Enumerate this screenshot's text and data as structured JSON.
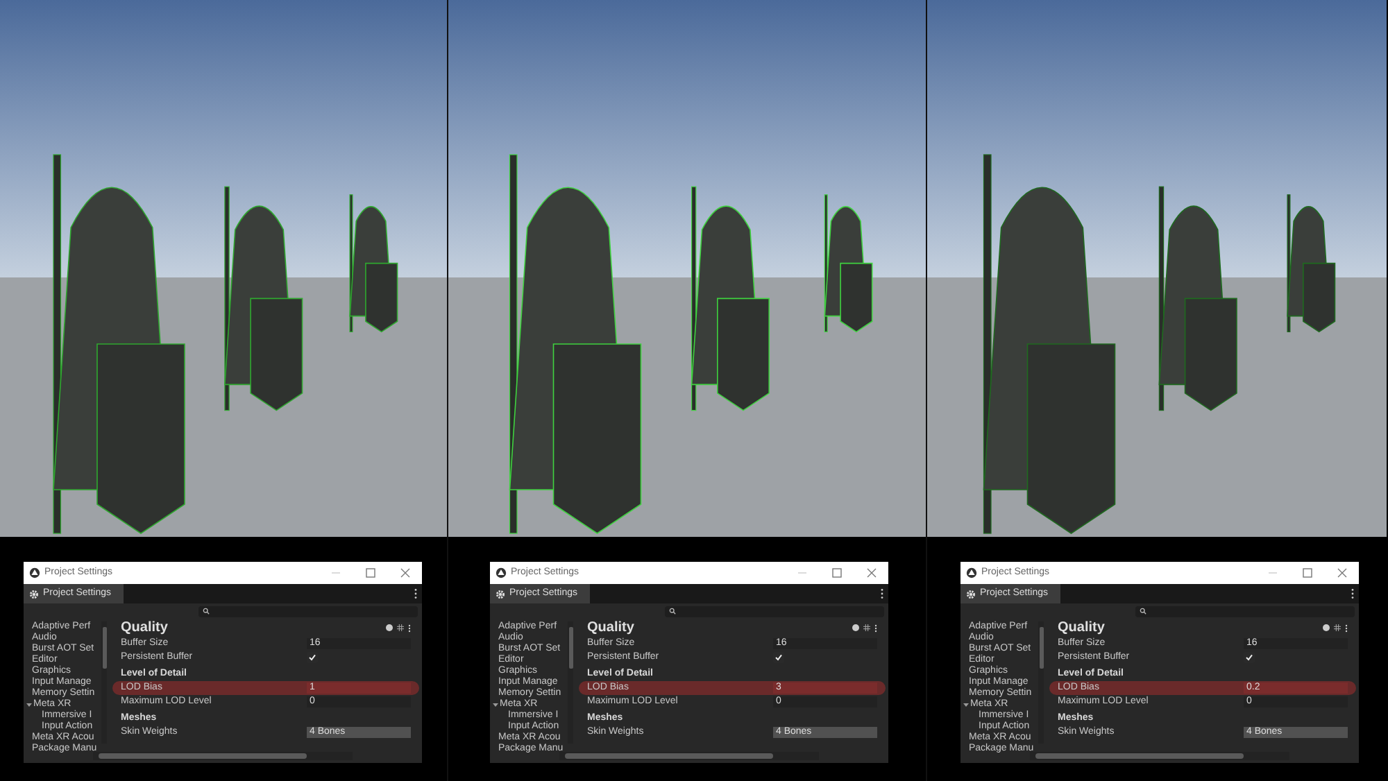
{
  "panels": [
    {
      "window": {
        "title": "Project Settings",
        "tab": "Project Settings",
        "sidebar": [
          {
            "label": "Adaptive Perf"
          },
          {
            "label": "Audio"
          },
          {
            "label": "Burst AOT Set"
          },
          {
            "label": "Editor"
          },
          {
            "label": "Graphics"
          },
          {
            "label": "Input Manage"
          },
          {
            "label": "Memory Settin"
          },
          {
            "label": "Meta XR",
            "expanded": true,
            "children": [
              {
                "label": "Immersive I"
              },
              {
                "label": "Input Action"
              }
            ]
          },
          {
            "label": "Meta XR Acou"
          },
          {
            "label": "Package Manu"
          }
        ],
        "heading": "Quality",
        "rows": [
          {
            "kind": "field",
            "label": "Buffer Size",
            "value": "16",
            "highlighted": false
          },
          {
            "kind": "checkbox",
            "label": "Persistent Buffer",
            "checked": true
          },
          {
            "kind": "section",
            "label": "Level of Detail"
          },
          {
            "kind": "field",
            "label": "LOD Bias",
            "value": "1",
            "highlighted": true
          },
          {
            "kind": "field",
            "label": "Maximum LOD Level",
            "value": "0",
            "highlighted": false
          },
          {
            "kind": "section",
            "label": "Meshes"
          },
          {
            "kind": "dropdown",
            "label": "Skin Weights",
            "value": "4 Bones"
          }
        ]
      }
    },
    {
      "window": {
        "title": "Project Settings",
        "tab": "Project Settings",
        "sidebar": [
          {
            "label": "Adaptive Perf"
          },
          {
            "label": "Audio"
          },
          {
            "label": "Burst AOT Set"
          },
          {
            "label": "Editor"
          },
          {
            "label": "Graphics"
          },
          {
            "label": "Input Manage"
          },
          {
            "label": "Memory Settin"
          },
          {
            "label": "Meta XR",
            "expanded": true,
            "children": [
              {
                "label": "Immersive I"
              },
              {
                "label": "Input Action"
              }
            ]
          },
          {
            "label": "Meta XR Acou"
          },
          {
            "label": "Package Manu"
          }
        ],
        "heading": "Quality",
        "rows": [
          {
            "kind": "field",
            "label": "Buffer Size",
            "value": "16",
            "highlighted": false
          },
          {
            "kind": "checkbox",
            "label": "Persistent Buffer",
            "checked": true
          },
          {
            "kind": "section",
            "label": "Level of Detail"
          },
          {
            "kind": "field",
            "label": "LOD Bias",
            "value": "3",
            "highlighted": true
          },
          {
            "kind": "field",
            "label": "Maximum LOD Level",
            "value": "0",
            "highlighted": false
          },
          {
            "kind": "section",
            "label": "Meshes"
          },
          {
            "kind": "dropdown",
            "label": "Skin Weights",
            "value": "4 Bones"
          }
        ]
      }
    },
    {
      "window": {
        "title": "Project Settings",
        "tab": "Project Settings",
        "sidebar": [
          {
            "label": "Adaptive Perf"
          },
          {
            "label": "Audio"
          },
          {
            "label": "Burst AOT Set"
          },
          {
            "label": "Editor"
          },
          {
            "label": "Graphics"
          },
          {
            "label": "Input Manage"
          },
          {
            "label": "Memory Settin"
          },
          {
            "label": "Meta XR",
            "expanded": true,
            "children": [
              {
                "label": "Immersive I"
              },
              {
                "label": "Input Action"
              }
            ]
          },
          {
            "label": "Meta XR Acou"
          },
          {
            "label": "Package Manu"
          }
        ],
        "heading": "Quality",
        "rows": [
          {
            "kind": "field",
            "label": "Buffer Size",
            "value": "16",
            "highlighted": false
          },
          {
            "kind": "checkbox",
            "label": "Persistent Buffer",
            "checked": true
          },
          {
            "kind": "section",
            "label": "Level of Detail"
          },
          {
            "kind": "field",
            "label": "LOD Bias",
            "value": "0.2",
            "highlighted": true
          },
          {
            "kind": "field",
            "label": "Maximum LOD Level",
            "value": "0",
            "highlighted": false
          },
          {
            "kind": "section",
            "label": "Meshes"
          },
          {
            "kind": "dropdown",
            "label": "Skin Weights",
            "value": "4 Bones"
          }
        ]
      }
    }
  ]
}
